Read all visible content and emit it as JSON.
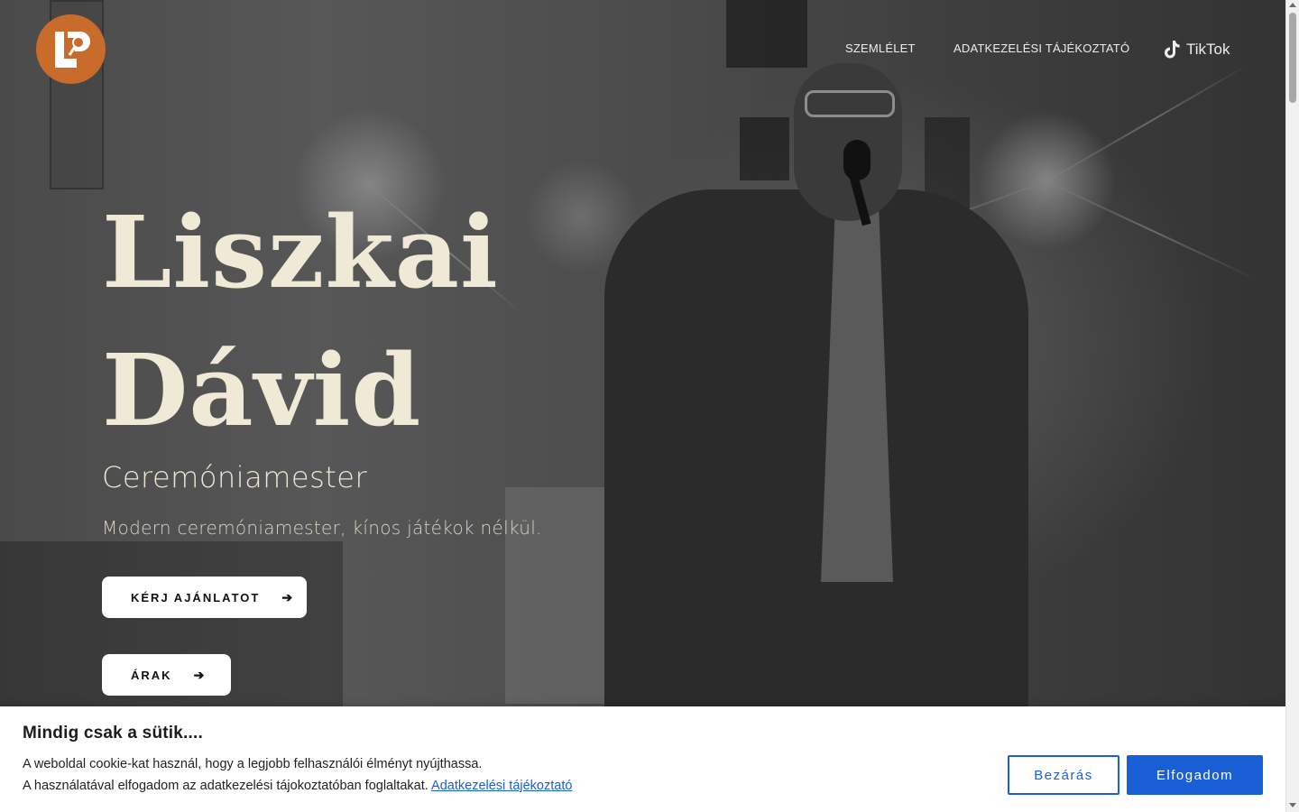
{
  "brand": {
    "logo_icon": "microphone-monogram-icon",
    "logo_color": "#c96b2a"
  },
  "nav": {
    "items": [
      {
        "label": "SZEMLÉLET"
      },
      {
        "label": "ADATKEZELÉSI TÁJÉKOZTATÓ"
      }
    ],
    "tiktok": {
      "label": "TikTok",
      "icon": "tiktok-icon"
    }
  },
  "hero": {
    "title_line_1": "Liszkai",
    "title_line_2": "Dávid",
    "subtitle": "Ceremóniamester",
    "tagline": "Modern ceremóniamester, kínos játékok nélkül.",
    "buttons": [
      {
        "label": "KÉRJ AJÁNLATOT",
        "icon": "arrow-right-icon"
      },
      {
        "label": "ÁRAK",
        "icon": "arrow-right-icon"
      }
    ]
  },
  "cookie": {
    "title": "Mindig csak a sütik....",
    "line_1": "A weboldal cookie-kat használ, hogy a legjobb felhasználói élményt nyújthassa.",
    "line_2": "A használatával elfogadom az adatkezelési tájokoztatóban foglaltakat.",
    "link_label": "Adatkezelési tájékoztató",
    "close_label": "Bezárás",
    "accept_label": "Elfogadom",
    "accent_color": "#1a5fd6"
  }
}
